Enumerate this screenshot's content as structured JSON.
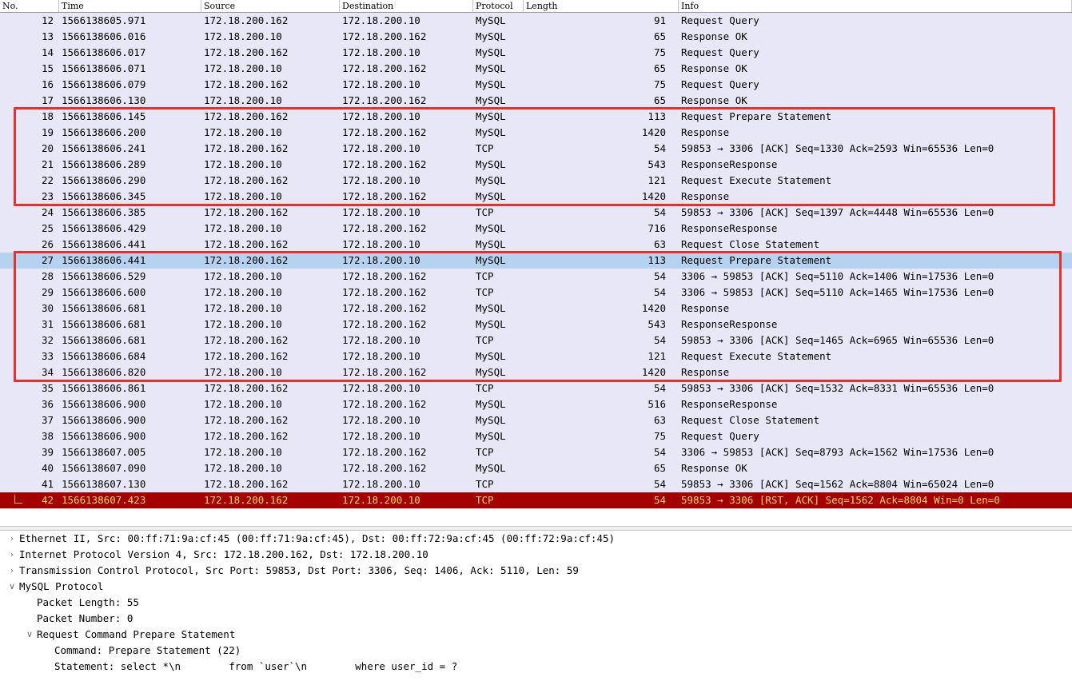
{
  "packet_list": {
    "columns": [
      {
        "key": "no",
        "label": "No."
      },
      {
        "key": "time",
        "label": "Time"
      },
      {
        "key": "source",
        "label": "Source"
      },
      {
        "key": "dest",
        "label": "Destination"
      },
      {
        "key": "protocol",
        "label": "Protocol"
      },
      {
        "key": "length",
        "label": "Length"
      },
      {
        "key": "info",
        "label": "Info"
      }
    ],
    "rows": [
      {
        "no": "12",
        "time": "1566138605.971",
        "source": "172.18.200.162",
        "dest": "172.18.200.10",
        "protocol": "MySQL",
        "length": "91",
        "info": "Request Query",
        "state": "default"
      },
      {
        "no": "13",
        "time": "1566138606.016",
        "source": "172.18.200.10",
        "dest": "172.18.200.162",
        "protocol": "MySQL",
        "length": "65",
        "info": "Response OK",
        "state": "default"
      },
      {
        "no": "14",
        "time": "1566138606.017",
        "source": "172.18.200.162",
        "dest": "172.18.200.10",
        "protocol": "MySQL",
        "length": "75",
        "info": "Request Query",
        "state": "default"
      },
      {
        "no": "15",
        "time": "1566138606.071",
        "source": "172.18.200.10",
        "dest": "172.18.200.162",
        "protocol": "MySQL",
        "length": "65",
        "info": "Response OK",
        "state": "default"
      },
      {
        "no": "16",
        "time": "1566138606.079",
        "source": "172.18.200.162",
        "dest": "172.18.200.10",
        "protocol": "MySQL",
        "length": "75",
        "info": "Request Query",
        "state": "default"
      },
      {
        "no": "17",
        "time": "1566138606.130",
        "source": "172.18.200.10",
        "dest": "172.18.200.162",
        "protocol": "MySQL",
        "length": "65",
        "info": "Response OK",
        "state": "default"
      },
      {
        "no": "18",
        "time": "1566138606.145",
        "source": "172.18.200.162",
        "dest": "172.18.200.10",
        "protocol": "MySQL",
        "length": "113",
        "info": "Request Prepare Statement",
        "state": "default"
      },
      {
        "no": "19",
        "time": "1566138606.200",
        "source": "172.18.200.10",
        "dest": "172.18.200.162",
        "protocol": "MySQL",
        "length": "1420",
        "info": "Response",
        "state": "default"
      },
      {
        "no": "20",
        "time": "1566138606.241",
        "source": "172.18.200.162",
        "dest": "172.18.200.10",
        "protocol": "TCP",
        "length": "54",
        "info": "59853 → 3306 [ACK] Seq=1330 Ack=2593 Win=65536 Len=0",
        "state": "default"
      },
      {
        "no": "21",
        "time": "1566138606.289",
        "source": "172.18.200.10",
        "dest": "172.18.200.162",
        "protocol": "MySQL",
        "length": "543",
        "info": "ResponseResponse",
        "state": "default"
      },
      {
        "no": "22",
        "time": "1566138606.290",
        "source": "172.18.200.162",
        "dest": "172.18.200.10",
        "protocol": "MySQL",
        "length": "121",
        "info": "Request Execute Statement",
        "state": "default"
      },
      {
        "no": "23",
        "time": "1566138606.345",
        "source": "172.18.200.10",
        "dest": "172.18.200.162",
        "protocol": "MySQL",
        "length": "1420",
        "info": "Response",
        "state": "default"
      },
      {
        "no": "24",
        "time": "1566138606.385",
        "source": "172.18.200.162",
        "dest": "172.18.200.10",
        "protocol": "TCP",
        "length": "54",
        "info": "59853 → 3306 [ACK] Seq=1397 Ack=4448 Win=65536 Len=0",
        "state": "default"
      },
      {
        "no": "25",
        "time": "1566138606.429",
        "source": "172.18.200.10",
        "dest": "172.18.200.162",
        "protocol": "MySQL",
        "length": "716",
        "info": "ResponseResponse",
        "state": "default"
      },
      {
        "no": "26",
        "time": "1566138606.441",
        "source": "172.18.200.162",
        "dest": "172.18.200.10",
        "protocol": "MySQL",
        "length": "63",
        "info": "Request Close Statement",
        "state": "default"
      },
      {
        "no": "27",
        "time": "1566138606.441",
        "source": "172.18.200.162",
        "dest": "172.18.200.10",
        "protocol": "MySQL",
        "length": "113",
        "info": "Request Prepare Statement",
        "state": "selected"
      },
      {
        "no": "28",
        "time": "1566138606.529",
        "source": "172.18.200.10",
        "dest": "172.18.200.162",
        "protocol": "TCP",
        "length": "54",
        "info": "3306 → 59853 [ACK] Seq=5110 Ack=1406 Win=17536 Len=0",
        "state": "default"
      },
      {
        "no": "29",
        "time": "1566138606.600",
        "source": "172.18.200.10",
        "dest": "172.18.200.162",
        "protocol": "TCP",
        "length": "54",
        "info": "3306 → 59853 [ACK] Seq=5110 Ack=1465 Win=17536 Len=0",
        "state": "default"
      },
      {
        "no": "30",
        "time": "1566138606.681",
        "source": "172.18.200.10",
        "dest": "172.18.200.162",
        "protocol": "MySQL",
        "length": "1420",
        "info": "Response",
        "state": "default"
      },
      {
        "no": "31",
        "time": "1566138606.681",
        "source": "172.18.200.10",
        "dest": "172.18.200.162",
        "protocol": "MySQL",
        "length": "543",
        "info": "ResponseResponse",
        "state": "default"
      },
      {
        "no": "32",
        "time": "1566138606.681",
        "source": "172.18.200.162",
        "dest": "172.18.200.10",
        "protocol": "TCP",
        "length": "54",
        "info": "59853 → 3306 [ACK] Seq=1465 Ack=6965 Win=65536 Len=0",
        "state": "default"
      },
      {
        "no": "33",
        "time": "1566138606.684",
        "source": "172.18.200.162",
        "dest": "172.18.200.10",
        "protocol": "MySQL",
        "length": "121",
        "info": "Request Execute Statement",
        "state": "default"
      },
      {
        "no": "34",
        "time": "1566138606.820",
        "source": "172.18.200.10",
        "dest": "172.18.200.162",
        "protocol": "MySQL",
        "length": "1420",
        "info": "Response",
        "state": "default"
      },
      {
        "no": "35",
        "time": "1566138606.861",
        "source": "172.18.200.162",
        "dest": "172.18.200.10",
        "protocol": "TCP",
        "length": "54",
        "info": "59853 → 3306 [ACK] Seq=1532 Ack=8331 Win=65536 Len=0",
        "state": "default"
      },
      {
        "no": "36",
        "time": "1566138606.900",
        "source": "172.18.200.10",
        "dest": "172.18.200.162",
        "protocol": "MySQL",
        "length": "516",
        "info": "ResponseResponse",
        "state": "default"
      },
      {
        "no": "37",
        "time": "1566138606.900",
        "source": "172.18.200.162",
        "dest": "172.18.200.10",
        "protocol": "MySQL",
        "length": "63",
        "info": "Request Close Statement",
        "state": "default"
      },
      {
        "no": "38",
        "time": "1566138606.900",
        "source": "172.18.200.162",
        "dest": "172.18.200.10",
        "protocol": "MySQL",
        "length": "75",
        "info": "Request Query",
        "state": "default"
      },
      {
        "no": "39",
        "time": "1566138607.005",
        "source": "172.18.200.10",
        "dest": "172.18.200.162",
        "protocol": "TCP",
        "length": "54",
        "info": "3306 → 59853 [ACK] Seq=8793 Ack=1562 Win=17536 Len=0",
        "state": "default"
      },
      {
        "no": "40",
        "time": "1566138607.090",
        "source": "172.18.200.10",
        "dest": "172.18.200.162",
        "protocol": "MySQL",
        "length": "65",
        "info": "Response OK",
        "state": "default"
      },
      {
        "no": "41",
        "time": "1566138607.130",
        "source": "172.18.200.162",
        "dest": "172.18.200.10",
        "protocol": "TCP",
        "length": "54",
        "info": "59853 → 3306 [ACK] Seq=1562 Ack=8804 Win=65024 Len=0",
        "state": "default"
      },
      {
        "no": "42",
        "time": "1566138607.423",
        "source": "172.18.200.162",
        "dest": "172.18.200.10",
        "protocol": "TCP",
        "length": "54",
        "info": "59853 → 3306 [RST, ACK] Seq=1562 Ack=8804 Win=0 Len=0",
        "state": "bad"
      }
    ],
    "annotations": [
      {
        "name": "prepare-execute-cycle-1",
        "first_row": "18",
        "last_row": "23",
        "color": "#e8302a"
      },
      {
        "name": "prepare-execute-cycle-2",
        "first_row": "27",
        "last_row": "34",
        "color": "#e8302a"
      }
    ],
    "scrollbar": {
      "left_arrow": "‹"
    }
  },
  "detail_tree": {
    "nodes": [
      {
        "indent": 0,
        "expander": "collapsed",
        "label": "Ethernet II, Src: 00:ff:71:9a:cf:45 (00:ff:71:9a:cf:45), Dst: 00:ff:72:9a:cf:45 (00:ff:72:9a:cf:45)"
      },
      {
        "indent": 0,
        "expander": "collapsed",
        "label": "Internet Protocol Version 4, Src: 172.18.200.162, Dst: 172.18.200.10"
      },
      {
        "indent": 0,
        "expander": "collapsed",
        "label": "Transmission Control Protocol, Src Port: 59853, Dst Port: 3306, Seq: 1406, Ack: 5110, Len: 59"
      },
      {
        "indent": 0,
        "expander": "expanded",
        "label": "MySQL Protocol"
      },
      {
        "indent": 1,
        "expander": "none",
        "label": "Packet Length: 55"
      },
      {
        "indent": 1,
        "expander": "none",
        "label": "Packet Number: 0"
      },
      {
        "indent": 1,
        "expander": "expanded",
        "label": "Request Command Prepare Statement"
      },
      {
        "indent": 2,
        "expander": "none",
        "label": "Command: Prepare Statement (22)"
      },
      {
        "indent": 2,
        "expander": "none",
        "label": "Statement: select *\\n        from `user`\\n        where user_id = ?"
      }
    ],
    "glyphs": {
      "collapsed": "›",
      "expanded": "∨"
    }
  },
  "colors": {
    "row_default_bg": "#e7e7f7",
    "row_selected_bg": "#b5d3f0",
    "row_bad_bg": "#a40000",
    "row_bad_fg": "#ffd86b",
    "annotation": "#e8302a",
    "header_bg": "#ffffff",
    "scrollbar_track": "#d0d0d0"
  }
}
